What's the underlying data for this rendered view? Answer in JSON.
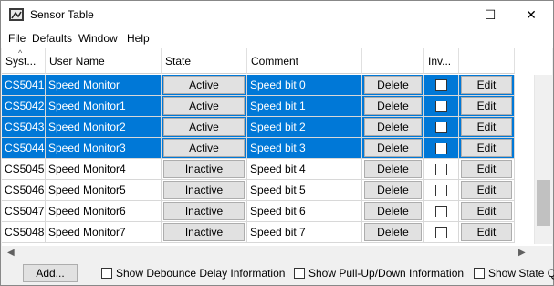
{
  "window": {
    "title": "Sensor Table",
    "minimize_glyph": "—",
    "maximize_glyph": "☐",
    "close_glyph": "✕"
  },
  "menu": [
    "File",
    "Defaults",
    "Window",
    "Help"
  ],
  "columns": [
    "System...",
    "User Name",
    "State",
    "Comment",
    "",
    "Inv..."
  ],
  "columns_display": [
    "Syst...",
    "User Name",
    "State",
    "Comment",
    "",
    "Inv...",
    ""
  ],
  "rows": [
    {
      "system": "CS5041",
      "user_name": "Speed Monitor",
      "state": "Active",
      "comment": "Speed bit 0",
      "delete": "Delete",
      "inverted": false,
      "edit": "Edit",
      "selected": true
    },
    {
      "system": "CS5042",
      "user_name": "Speed Monitor1",
      "state": "Active",
      "comment": "Speed bit 1",
      "delete": "Delete",
      "inverted": false,
      "edit": "Edit",
      "selected": true
    },
    {
      "system": "CS5043",
      "user_name": "Speed Monitor2",
      "state": "Active",
      "comment": "Speed bit 2",
      "delete": "Delete",
      "inverted": false,
      "edit": "Edit",
      "selected": true
    },
    {
      "system": "CS5044",
      "user_name": "Speed Monitor3",
      "state": "Active",
      "comment": "Speed bit 3",
      "delete": "Delete",
      "inverted": false,
      "edit": "Edit",
      "selected": true
    },
    {
      "system": "CS5045",
      "user_name": "Speed Monitor4",
      "state": "Inactive",
      "comment": "Speed bit 4",
      "delete": "Delete",
      "inverted": false,
      "edit": "Edit",
      "selected": false
    },
    {
      "system": "CS5046",
      "user_name": "Speed Monitor5",
      "state": "Inactive",
      "comment": "Speed bit 5",
      "delete": "Delete",
      "inverted": false,
      "edit": "Edit",
      "selected": false
    },
    {
      "system": "CS5047",
      "user_name": "Speed Monitor6",
      "state": "Inactive",
      "comment": "Speed bit 6",
      "delete": "Delete",
      "inverted": false,
      "edit": "Edit",
      "selected": false
    },
    {
      "system": "CS5048",
      "user_name": "Speed Monitor7",
      "state": "Inactive",
      "comment": "Speed bit 7",
      "delete": "Delete",
      "inverted": false,
      "edit": "Edit",
      "selected": false
    }
  ],
  "bottom": {
    "add_label": "Add...",
    "options": [
      "Show Debounce Delay Information",
      "Show Pull-Up/Down Information",
      "Show State Qu"
    ]
  },
  "colors": {
    "selection": "#0078d7",
    "button": "#e1e1e1"
  }
}
